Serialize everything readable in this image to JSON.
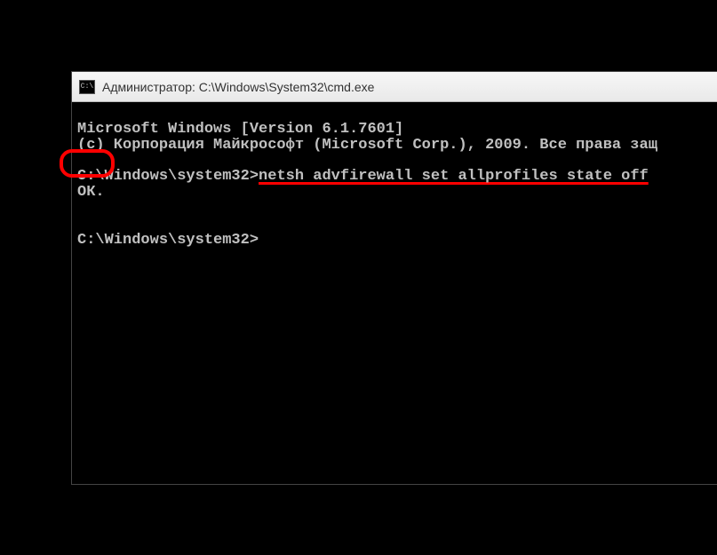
{
  "titlebar": {
    "icon_label": "C:\\",
    "title": "Администратор: C:\\Windows\\System32\\cmd.exe"
  },
  "terminal": {
    "line1": "Microsoft Windows [Version 6.1.7601]",
    "line2": "(c) Корпорация Майкрософт (Microsoft Corp.), 2009. Все права защ",
    "prompt1_prefix": "C:\\Windows\\system32>",
    "command": "netsh advfirewall set allprofiles state off",
    "ok": "ОК.",
    "prompt2": "C:\\Windows\\system32>"
  }
}
